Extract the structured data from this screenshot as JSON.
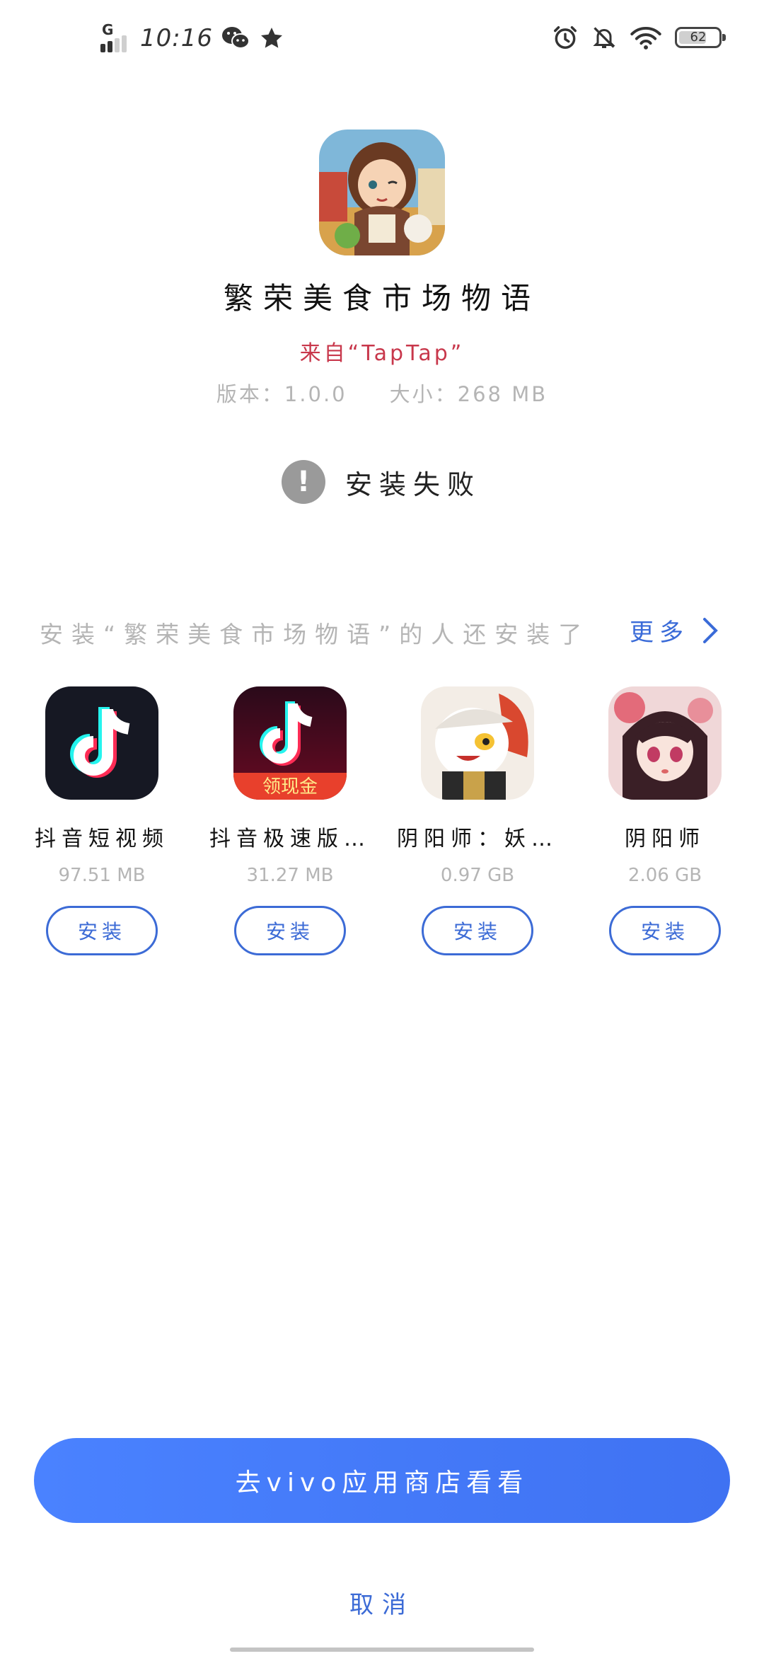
{
  "status_bar": {
    "network_label": "G",
    "time": "10:16",
    "battery": "62",
    "icons": [
      "signal-icon",
      "wechat-icon",
      "star-icon",
      "alarm-icon",
      "mute-bell-icon",
      "wifi-icon",
      "battery-icon"
    ]
  },
  "app": {
    "title": "繁荣美食市场物语",
    "source": "来自“TapTap”",
    "version_label": "版本：",
    "version": "1.0.0",
    "size_label": "大小：",
    "size": "268 MB"
  },
  "status": {
    "text": "安装失败",
    "icon": "warning-icon"
  },
  "recommend": {
    "header": "安装“繁荣美食市场物语”的人还安装了",
    "more": "更多",
    "items": [
      {
        "name": "抖音短视频",
        "size": "97.51 MB",
        "install": "安装"
      },
      {
        "name": "抖音极速版…",
        "size": "31.27 MB",
        "install": "安装"
      },
      {
        "name": "阴阳师：妖…",
        "size": "0.97 GB",
        "install": "安装"
      },
      {
        "name": "阴阳师",
        "size": "2.06 GB",
        "install": "安装"
      }
    ],
    "badge_text": "领现金"
  },
  "actions": {
    "store_button": "去vivo应用商店看看",
    "cancel": "取消"
  },
  "colors": {
    "accent": "#3c6bd6",
    "source_red": "#c8374b",
    "muted": "#b5b5b5",
    "store_gradient_start": "#4a82ff"
  }
}
